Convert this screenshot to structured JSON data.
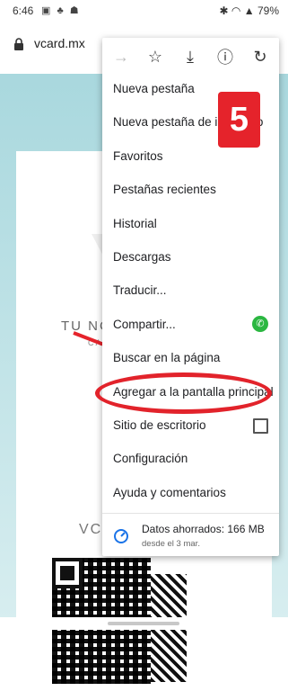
{
  "status": {
    "time": "6:46",
    "battery": "79%",
    "notification_icons": "▣ ♣ ☗",
    "signal_icons": "✱ ◠ ▲"
  },
  "browser": {
    "url": "vcard.mx"
  },
  "page": {
    "heading": "TU NC",
    "subheading": "CA",
    "section": "VC"
  },
  "menu": {
    "items": [
      {
        "label": "Nueva pestaña"
      },
      {
        "label": "Nueva pestaña de incógnito"
      },
      {
        "label": "Favoritos"
      },
      {
        "label": "Pestañas recientes"
      },
      {
        "label": "Historial"
      },
      {
        "label": "Descargas"
      },
      {
        "label": "Traducir..."
      },
      {
        "label": "Compartir..."
      },
      {
        "label": "Buscar en la página"
      },
      {
        "label": "Agregar a la pantalla principal"
      },
      {
        "label": "Sitio de escritorio"
      },
      {
        "label": "Configuración"
      },
      {
        "label": "Ayuda y comentarios"
      }
    ],
    "data_saver": {
      "title": "Datos ahorrados: 166 MB",
      "subtitle": "desde el 3 mar."
    }
  },
  "annotation": {
    "step": "5",
    "color": "#e5232b"
  },
  "icons": [
    "forward-icon",
    "star-icon",
    "download-icon",
    "info-icon",
    "refresh-icon",
    "lock-icon",
    "whatsapp-icon",
    "checkbox-icon",
    "data-saver-icon"
  ]
}
